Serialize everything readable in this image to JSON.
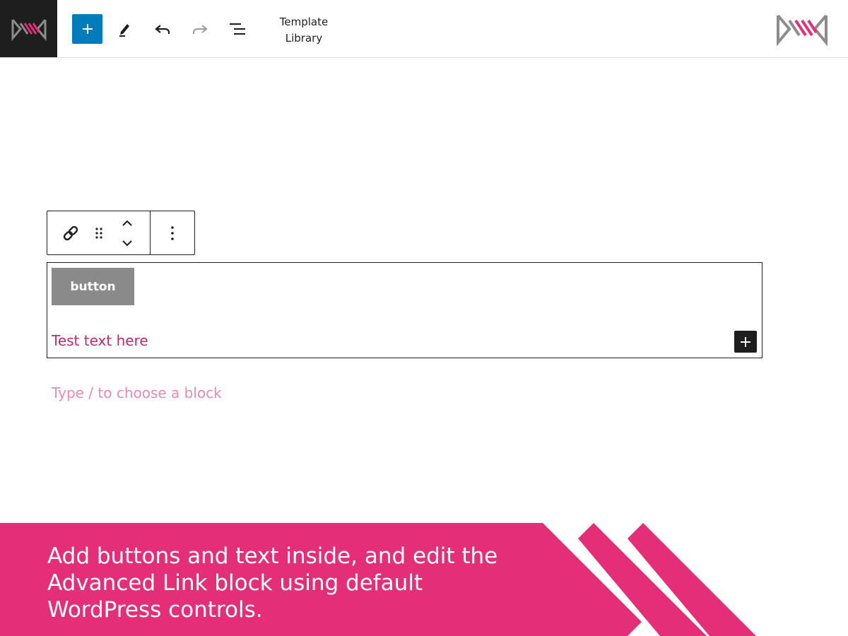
{
  "topbar": {
    "inserter_label": "+",
    "template_library_line1": "Template",
    "template_library_line2": "Library"
  },
  "icons": {
    "site_logo": "brand-logo-icon",
    "inserter": "plus-icon",
    "tools": "pencil-icon",
    "undo": "undo-icon",
    "redo": "redo-icon",
    "list_view": "list-view-icon",
    "link": "link-icon",
    "drag": "drag-handle-icon",
    "move": "chevron-up-down-icon",
    "options": "more-vertical-icon",
    "append": "plus-icon"
  },
  "block": {
    "button_label": "button",
    "text": "Test text here",
    "placeholder": "Type / to choose a block"
  },
  "banner": {
    "line1": "Add buttons and text inside, and edit the",
    "line2": "Advanced Link block using default",
    "line3": "WordPress controls."
  },
  "colors": {
    "accent_blue": "#007cba",
    "brand_pink": "#e42e77",
    "text_pink": "#c6266d",
    "placeholder_pink": "#e98ab3",
    "button_gray": "#8a8a8a",
    "dark": "#1e1e1e"
  }
}
